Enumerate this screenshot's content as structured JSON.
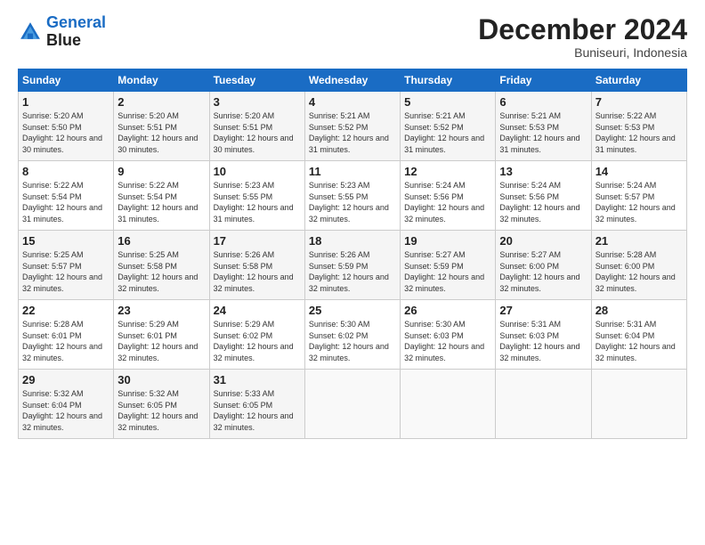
{
  "logo": {
    "line1": "General",
    "line2": "Blue"
  },
  "header": {
    "title": "December 2024",
    "subtitle": "Buniseuri, Indonesia"
  },
  "days_of_week": [
    "Sunday",
    "Monday",
    "Tuesday",
    "Wednesday",
    "Thursday",
    "Friday",
    "Saturday"
  ],
  "weeks": [
    [
      {
        "day": "1",
        "sunrise": "5:20 AM",
        "sunset": "5:50 PM",
        "daylight": "12 hours and 30 minutes."
      },
      {
        "day": "2",
        "sunrise": "5:20 AM",
        "sunset": "5:51 PM",
        "daylight": "12 hours and 30 minutes."
      },
      {
        "day": "3",
        "sunrise": "5:20 AM",
        "sunset": "5:51 PM",
        "daylight": "12 hours and 30 minutes."
      },
      {
        "day": "4",
        "sunrise": "5:21 AM",
        "sunset": "5:52 PM",
        "daylight": "12 hours and 31 minutes."
      },
      {
        "day": "5",
        "sunrise": "5:21 AM",
        "sunset": "5:52 PM",
        "daylight": "12 hours and 31 minutes."
      },
      {
        "day": "6",
        "sunrise": "5:21 AM",
        "sunset": "5:53 PM",
        "daylight": "12 hours and 31 minutes."
      },
      {
        "day": "7",
        "sunrise": "5:22 AM",
        "sunset": "5:53 PM",
        "daylight": "12 hours and 31 minutes."
      }
    ],
    [
      {
        "day": "8",
        "sunrise": "5:22 AM",
        "sunset": "5:54 PM",
        "daylight": "12 hours and 31 minutes."
      },
      {
        "day": "9",
        "sunrise": "5:22 AM",
        "sunset": "5:54 PM",
        "daylight": "12 hours and 31 minutes."
      },
      {
        "day": "10",
        "sunrise": "5:23 AM",
        "sunset": "5:55 PM",
        "daylight": "12 hours and 31 minutes."
      },
      {
        "day": "11",
        "sunrise": "5:23 AM",
        "sunset": "5:55 PM",
        "daylight": "12 hours and 32 minutes."
      },
      {
        "day": "12",
        "sunrise": "5:24 AM",
        "sunset": "5:56 PM",
        "daylight": "12 hours and 32 minutes."
      },
      {
        "day": "13",
        "sunrise": "5:24 AM",
        "sunset": "5:56 PM",
        "daylight": "12 hours and 32 minutes."
      },
      {
        "day": "14",
        "sunrise": "5:24 AM",
        "sunset": "5:57 PM",
        "daylight": "12 hours and 32 minutes."
      }
    ],
    [
      {
        "day": "15",
        "sunrise": "5:25 AM",
        "sunset": "5:57 PM",
        "daylight": "12 hours and 32 minutes."
      },
      {
        "day": "16",
        "sunrise": "5:25 AM",
        "sunset": "5:58 PM",
        "daylight": "12 hours and 32 minutes."
      },
      {
        "day": "17",
        "sunrise": "5:26 AM",
        "sunset": "5:58 PM",
        "daylight": "12 hours and 32 minutes."
      },
      {
        "day": "18",
        "sunrise": "5:26 AM",
        "sunset": "5:59 PM",
        "daylight": "12 hours and 32 minutes."
      },
      {
        "day": "19",
        "sunrise": "5:27 AM",
        "sunset": "5:59 PM",
        "daylight": "12 hours and 32 minutes."
      },
      {
        "day": "20",
        "sunrise": "5:27 AM",
        "sunset": "6:00 PM",
        "daylight": "12 hours and 32 minutes."
      },
      {
        "day": "21",
        "sunrise": "5:28 AM",
        "sunset": "6:00 PM",
        "daylight": "12 hours and 32 minutes."
      }
    ],
    [
      {
        "day": "22",
        "sunrise": "5:28 AM",
        "sunset": "6:01 PM",
        "daylight": "12 hours and 32 minutes."
      },
      {
        "day": "23",
        "sunrise": "5:29 AM",
        "sunset": "6:01 PM",
        "daylight": "12 hours and 32 minutes."
      },
      {
        "day": "24",
        "sunrise": "5:29 AM",
        "sunset": "6:02 PM",
        "daylight": "12 hours and 32 minutes."
      },
      {
        "day": "25",
        "sunrise": "5:30 AM",
        "sunset": "6:02 PM",
        "daylight": "12 hours and 32 minutes."
      },
      {
        "day": "26",
        "sunrise": "5:30 AM",
        "sunset": "6:03 PM",
        "daylight": "12 hours and 32 minutes."
      },
      {
        "day": "27",
        "sunrise": "5:31 AM",
        "sunset": "6:03 PM",
        "daylight": "12 hours and 32 minutes."
      },
      {
        "day": "28",
        "sunrise": "5:31 AM",
        "sunset": "6:04 PM",
        "daylight": "12 hours and 32 minutes."
      }
    ],
    [
      {
        "day": "29",
        "sunrise": "5:32 AM",
        "sunset": "6:04 PM",
        "daylight": "12 hours and 32 minutes."
      },
      {
        "day": "30",
        "sunrise": "5:32 AM",
        "sunset": "6:05 PM",
        "daylight": "12 hours and 32 minutes."
      },
      {
        "day": "31",
        "sunrise": "5:33 AM",
        "sunset": "6:05 PM",
        "daylight": "12 hours and 32 minutes."
      },
      null,
      null,
      null,
      null
    ]
  ],
  "labels": {
    "sunrise": "Sunrise:",
    "sunset": "Sunset:",
    "daylight": "Daylight:"
  }
}
